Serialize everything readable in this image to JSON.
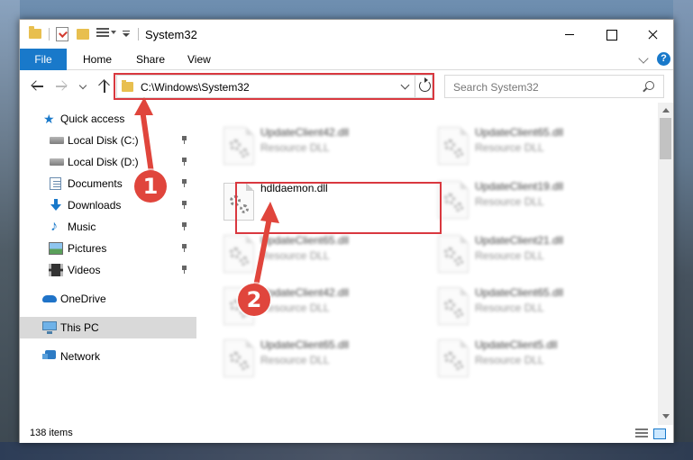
{
  "window": {
    "title": "System32"
  },
  "ribbon": {
    "file_label": "File",
    "home_label": "Home",
    "share_label": "Share",
    "view_label": "View",
    "help_label": "?"
  },
  "address": {
    "path": "C:\\Windows\\System32"
  },
  "search": {
    "placeholder": "Search System32"
  },
  "sidebar": {
    "items": [
      {
        "label": "Quick access",
        "icon": "star-icon"
      },
      {
        "label": "Local Disk (C:)",
        "icon": "disk-icon",
        "pinned": true
      },
      {
        "label": "Local Disk (D:)",
        "icon": "disk-icon",
        "pinned": true
      },
      {
        "label": "Documents",
        "icon": "documents-icon",
        "pinned": true
      },
      {
        "label": "Downloads",
        "icon": "download-icon",
        "pinned": true
      },
      {
        "label": "Music",
        "icon": "music-icon",
        "pinned": true
      },
      {
        "label": "Pictures",
        "icon": "pictures-icon",
        "pinned": true
      },
      {
        "label": "Videos",
        "icon": "videos-icon",
        "pinned": true
      },
      {
        "label": "OneDrive",
        "icon": "onedrive-icon"
      },
      {
        "label": "This PC",
        "icon": "computer-icon",
        "selected": true
      },
      {
        "label": "Network",
        "icon": "network-icon"
      }
    ]
  },
  "files": [
    {
      "name": "UpdateClient42.dll",
      "type": "Resource DLL"
    },
    {
      "name": "UpdateClient65.dll",
      "type": "Resource DLL"
    },
    {
      "name": "hdldaemon.dll",
      "type": ""
    },
    {
      "name": "UpdateClient19.dll",
      "type": "Resource DLL"
    },
    {
      "name": "UpdateClient65.dll",
      "type": "Resource DLL"
    },
    {
      "name": "UpdateClient21.dll",
      "type": "Resource DLL"
    },
    {
      "name": "UpdateClient42.dll",
      "type": "Resource DLL"
    },
    {
      "name": "UpdateClient65.dll",
      "type": "Resource DLL"
    },
    {
      "name": "UpdateClient65.dll",
      "type": "Resource DLL"
    },
    {
      "name": "UpdateClient5.dll",
      "type": "Resource DLL"
    }
  ],
  "status": {
    "item_count": "138 items"
  },
  "annotations": {
    "step1": "1",
    "step2": "2"
  },
  "colors": {
    "accent": "#1979ca",
    "highlight": "#d9383f",
    "badge": "#e0453c"
  }
}
